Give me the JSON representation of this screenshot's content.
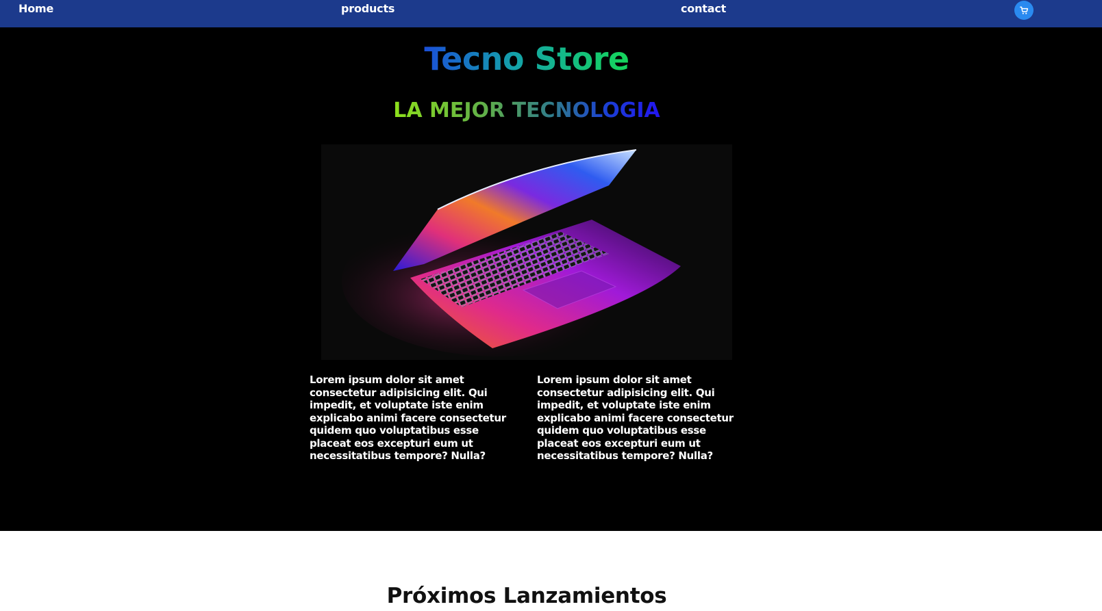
{
  "nav": {
    "home_label": "Home",
    "products_label": "products",
    "contact_label": "contact",
    "cart_icon": "cart-icon"
  },
  "hero": {
    "title": "Tecno Store",
    "subtitle": "LA MEJOR TECNOLOGIA",
    "image_subject": "laptop-image",
    "paragraphs": [
      "Lorem ipsum dolor sit amet consectetur adipisicing elit. Qui impedit, et voluptate iste enim explicabo animi facere consectetur quidem quo voluptatibus esse placeat eos excepturi eum ut necessitatibus tempore? Nulla?",
      "Lorem ipsum dolor sit amet consectetur adipisicing elit. Qui impedit, et voluptate iste enim explicabo animi facere consectetur quidem quo voluptatibus esse placeat eos excepturi eum ut necessitatibus tempore? Nulla?"
    ]
  },
  "upcoming": {
    "title": "Próximos Lanzamientos"
  },
  "colors": {
    "navbar_bg": "#1c3a8c",
    "hero_bg": "#000000",
    "cart_button": "#2a8af0",
    "title_gradient": [
      "#1a4fd8",
      "#15d65a"
    ],
    "subtitle_gradient": [
      "#8ee01b",
      "#2315f0"
    ]
  }
}
